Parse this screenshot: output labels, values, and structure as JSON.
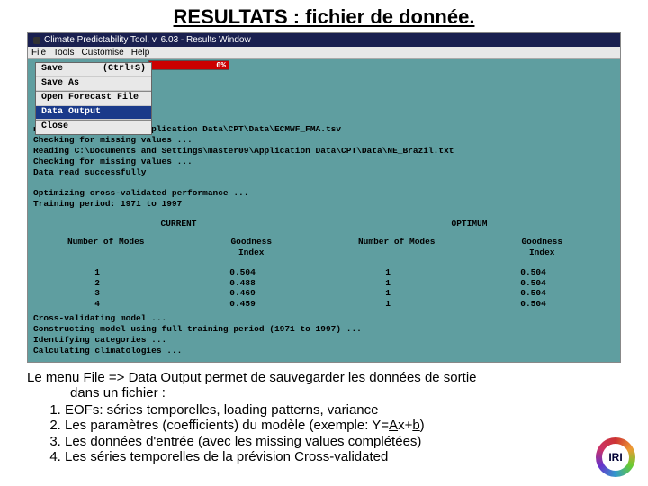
{
  "slide": {
    "title": "RESULTATS : fichier de donnée."
  },
  "window": {
    "title": "Climate Predictability Tool, v. 6.03 - Results Window"
  },
  "menubar": {
    "items": [
      "File",
      "Tools",
      "Customise",
      "Help"
    ]
  },
  "file_menu": {
    "save": "Save",
    "save_shortcut": "(Ctrl+S)",
    "save_as": "Save As",
    "open_forecast": "Open Forecast File",
    "data_output": "Data Output",
    "close": "Close"
  },
  "progress": {
    "label": "0%"
  },
  "console": {
    "pre": "nd Settings\\master09\\Application Data\\CPT\\Data\\ECMWF_FMA.tsv\nChecking for missing values ...\nReading C:\\Documents and Settings\\master09\\Application Data\\CPT\\Data\\NE_Brazil.txt\nChecking for missing values ...\nData read successfully\n\nOptimizing cross-validated performance ...\nTraining period: 1971 to 1997",
    "col_current": "CURRENT",
    "col_optimum": "OPTIMUM",
    "sub_modes": "Number of Modes",
    "sub_goodness": "Goodness\nIndex",
    "rows": [
      {
        "a": "1",
        "b": "0.504",
        "c": "1",
        "d": "0.504"
      },
      {
        "a": "2",
        "b": "0.488",
        "c": "1",
        "d": "0.504"
      },
      {
        "a": "3",
        "b": "0.469",
        "c": "1",
        "d": "0.504"
      },
      {
        "a": "4",
        "b": "0.459",
        "c": "1",
        "d": "0.504"
      }
    ],
    "post": "Cross-validating model ...\nConstructing model using full training period (1971 to 1997) ...\nIdentifying categories ...\nCalculating climatologies ..."
  },
  "caption": {
    "line1a": "Le menu ",
    "u1": "File",
    "line1b": "  => ",
    "u2": "Data Output",
    "line1c": " permet de sauvegarder les données de sortie",
    "line2": "dans un fichier :",
    "items": [
      "EOFs: séries temporelles, loading patterns, variance",
      "Les paramètres (coefficients) du modèle (exemple: Y=Ax+b)",
      "Les données d'entrée (avec les missing values complétées)",
      "Les séries temporelles de la prévision Cross-validated"
    ],
    "item2_prefix": "Les paramètres (coefficients) du modèle (exemple: Y=",
    "A": "A",
    "item2_mid": "x+",
    "b": "b",
    "item2_suffix": ")"
  },
  "logo": {
    "text": "IRI"
  }
}
